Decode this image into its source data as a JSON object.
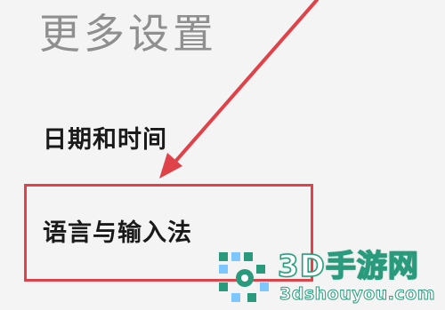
{
  "header": {
    "title": "更多设置"
  },
  "settings": {
    "items": [
      {
        "label": "日期和时间"
      },
      {
        "label": "语言与输入法",
        "highlighted": true
      }
    ]
  },
  "annotation": {
    "highlight_color": "#e0424a",
    "arrow_color": "#e0424a"
  },
  "watermark": {
    "title": "3D手游网",
    "domain": "3dshouyou.com",
    "color": "#2a9a7c"
  }
}
